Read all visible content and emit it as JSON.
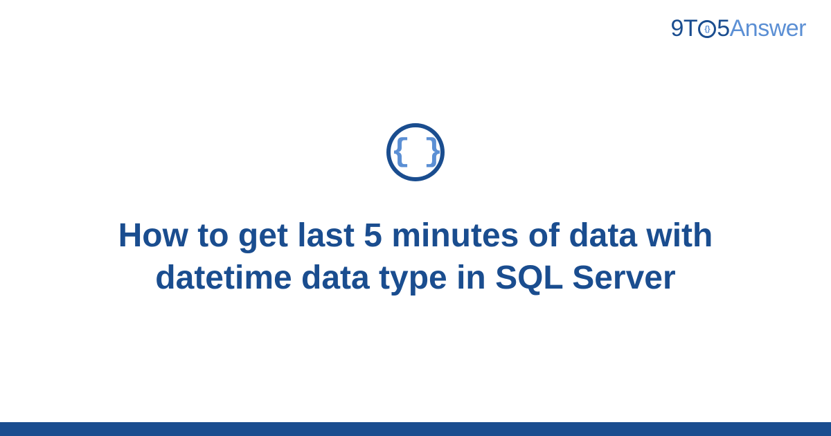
{
  "brand": {
    "nine": "9",
    "t": "T",
    "o_inner": "{}",
    "five": "5",
    "answer": "Answer"
  },
  "badge": {
    "glyph": "{ }"
  },
  "title": "How to get last 5 minutes of data with datetime data type in SQL Server",
  "colors": {
    "primary": "#1a4d8f",
    "accent": "#5b8fd4"
  }
}
